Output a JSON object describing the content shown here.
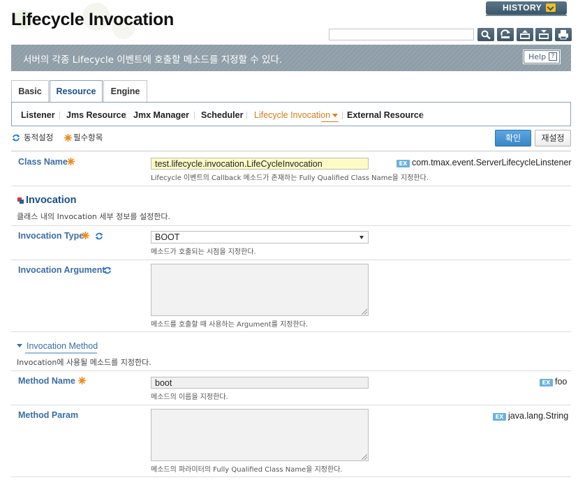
{
  "page": {
    "title": "Lifecycle Invocation",
    "description": "서버의 각종 Lifecycle 이벤트에 호출할 메소드를 지정할 수 있다."
  },
  "history": {
    "label": "HISTORY"
  },
  "help": {
    "label": "Help",
    "glyph": "?"
  },
  "toolbar": {
    "search_placeholder": "",
    "buttons": [
      {
        "name": "search-button",
        "icon": "magnifier-icon"
      },
      {
        "name": "refresh-button",
        "icon": "refresh-icon"
      },
      {
        "name": "xml-export-button",
        "icon": "xml-icon",
        "label": "XML"
      },
      {
        "name": "xml-import-button",
        "icon": "xml-icon",
        "label": "XML"
      },
      {
        "name": "print-button",
        "icon": "print-icon"
      }
    ]
  },
  "tabs": [
    {
      "label": "Basic",
      "active": false
    },
    {
      "label": "Resource",
      "active": true
    },
    {
      "label": "Engine",
      "active": false
    }
  ],
  "subnav": [
    {
      "label": "Listener",
      "active": false
    },
    {
      "label": "Jms Resource",
      "active": false
    },
    {
      "label": "Jmx Manager",
      "active": false
    },
    {
      "label": "Scheduler",
      "active": false
    },
    {
      "label": "Lifecycle Invocation",
      "active": true
    },
    {
      "label": "External Resource",
      "active": false
    }
  ],
  "legend": {
    "dynamic": "동적설정",
    "required": "필수항목"
  },
  "actions": {
    "confirm": "확인",
    "reset": "재설정"
  },
  "fields": {
    "class_name": {
      "label": "Class Name",
      "value": "test.lifecycle.invocation.LifeCycleInvocation",
      "help": "Lifecycle 이벤트의 Callback 메소드가 존재하는 Fully Qualified Class Name을 지정한다.",
      "example_badge": "EX",
      "example": "com.tmax.event.ServerLifecycleLinstener"
    },
    "invocation_type": {
      "label": "Invocation Type",
      "value": "BOOT",
      "help": "메소드가 호출되는 시점을 지정한다."
    },
    "invocation_argument": {
      "label": "Invocation Argument",
      "value": "",
      "help": "메소드를 호출할 때 사용하는 Argument를 지정한다."
    },
    "method_name": {
      "label": "Method Name",
      "value": "boot",
      "help": "메소드의 이름을 지정한다.",
      "example_badge": "EX",
      "example": "foo"
    },
    "method_param": {
      "label": "Method Param",
      "value": "",
      "help": "메소드의 파라미터의 Fully Qualified Class Name을 지정한다.",
      "example_badge": "EX",
      "example": "java.lang.String"
    }
  },
  "sections": {
    "invocation": {
      "title": "Invocation",
      "description": "클래스 내의 Invocation 세부 정보를 설정한다."
    },
    "invocation_method": {
      "title": "Invocation Method",
      "description": "Invocation에 사용될 메소드를 지정한다."
    }
  },
  "colors": {
    "accent": "#3a6ea5",
    "active_subnav": "#d67b1a",
    "banner": "#8e9da7",
    "confirm_button": "#3a86c6"
  }
}
